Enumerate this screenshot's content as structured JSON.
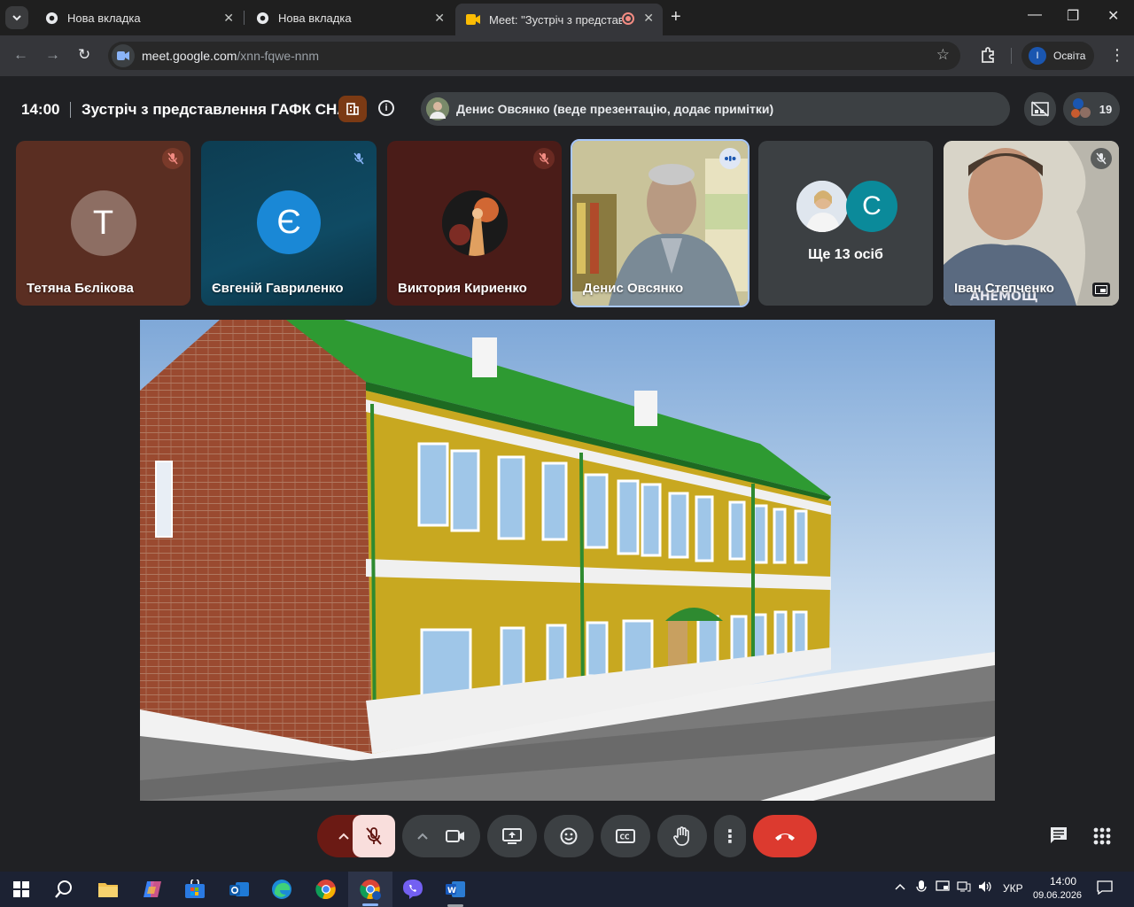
{
  "browser": {
    "tabs": [
      {
        "label": "Нова вкладка",
        "icon": "chrome-icon"
      },
      {
        "label": "Нова вкладка",
        "icon": "chrome-icon"
      },
      {
        "label": "Meet: \"Зустріч з представл",
        "icon": "meet-icon",
        "recording": true
      }
    ],
    "url_host": "meet.google.com",
    "url_path": "/xnn-fqwe-nnm",
    "profile_label": "Освіта",
    "profile_initial": "І"
  },
  "meeting": {
    "time": "14:00",
    "title": "Зустріч з представлення ГАФК СНАУ",
    "presenter_status": "Денис Овсянко (веде презентацію, додає примітки)",
    "participant_count": "19"
  },
  "participants": [
    {
      "name": "Тетяна Бєлікова",
      "initial": "Т",
      "muted": true,
      "bg": "#5a2e22",
      "avatar_color": "#8d6e63"
    },
    {
      "name": "Євгеній Гавриленко",
      "initial": "Є",
      "muted": true,
      "bg": "#0f4a63",
      "avatar_color": "#1a88d6"
    },
    {
      "name": "Виктория Кириенко",
      "initial": "",
      "muted": true,
      "bg": "#4a1c18",
      "avatar_color": "#1b1b1b"
    },
    {
      "name": "Денис Овсянко",
      "speaking": true
    },
    {
      "more_label": "Ще 13 осіб",
      "more_initial": "С"
    },
    {
      "name": "Іван Степченко",
      "muted": true
    }
  ],
  "controls": {
    "buttons": [
      "caret-up",
      "mic-off",
      "caret-up",
      "camera",
      "present",
      "emoji",
      "captions",
      "raise-hand",
      "more",
      "hang-up"
    ],
    "hangup_color": "#dc3a2f",
    "mic_off_color": "#f9dedc"
  },
  "taskbar": {
    "language": "УКР",
    "clock_time": "14:00",
    "clock_date": "09.06.2026"
  }
}
